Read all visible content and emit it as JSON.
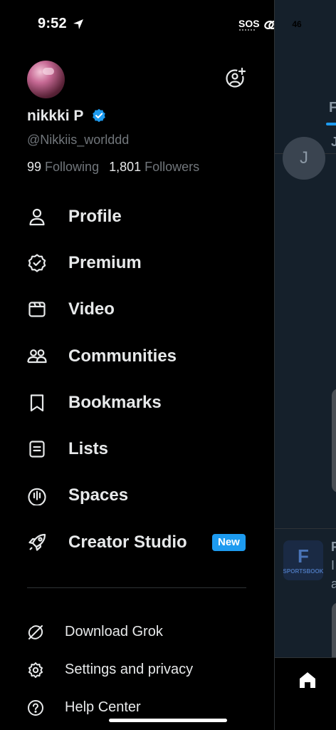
{
  "status_bar": {
    "time": "9:52",
    "sos": "SOS",
    "battery": "46",
    "battery_level": 0.46
  },
  "profile": {
    "name": "nikkki P",
    "handle": "@Nikkiis_worlddd",
    "following_count": "99",
    "following_label": "Following",
    "followers_count": "1,801",
    "followers_label": "Followers",
    "verified": true
  },
  "menu": {
    "items": [
      {
        "label": "Profile",
        "icon": "person-icon"
      },
      {
        "label": "Premium",
        "icon": "verified-badge-icon"
      },
      {
        "label": "Video",
        "icon": "video-icon"
      },
      {
        "label": "Communities",
        "icon": "communities-icon"
      },
      {
        "label": "Bookmarks",
        "icon": "bookmark-icon"
      },
      {
        "label": "Lists",
        "icon": "list-icon"
      },
      {
        "label": "Spaces",
        "icon": "spaces-icon"
      },
      {
        "label": "Creator Studio",
        "icon": "rocket-icon",
        "badge": "New"
      }
    ]
  },
  "sub_menu": {
    "items": [
      {
        "label": "Download Grok",
        "icon": "grok-icon"
      },
      {
        "label": "Settings and privacy",
        "icon": "gear-icon"
      },
      {
        "label": "Help Center",
        "icon": "help-icon"
      }
    ]
  },
  "feed": {
    "tab_initial": "F",
    "avatar_letter": "J",
    "author_initial": "J",
    "ad_brand": "SPORTSBOOK",
    "ad_line1": "F",
    "ad_line2": "I",
    "ad_line3": "a"
  },
  "colors": {
    "accent": "#1d9bf0",
    "background": "#000000",
    "text_secondary": "#71767b"
  }
}
